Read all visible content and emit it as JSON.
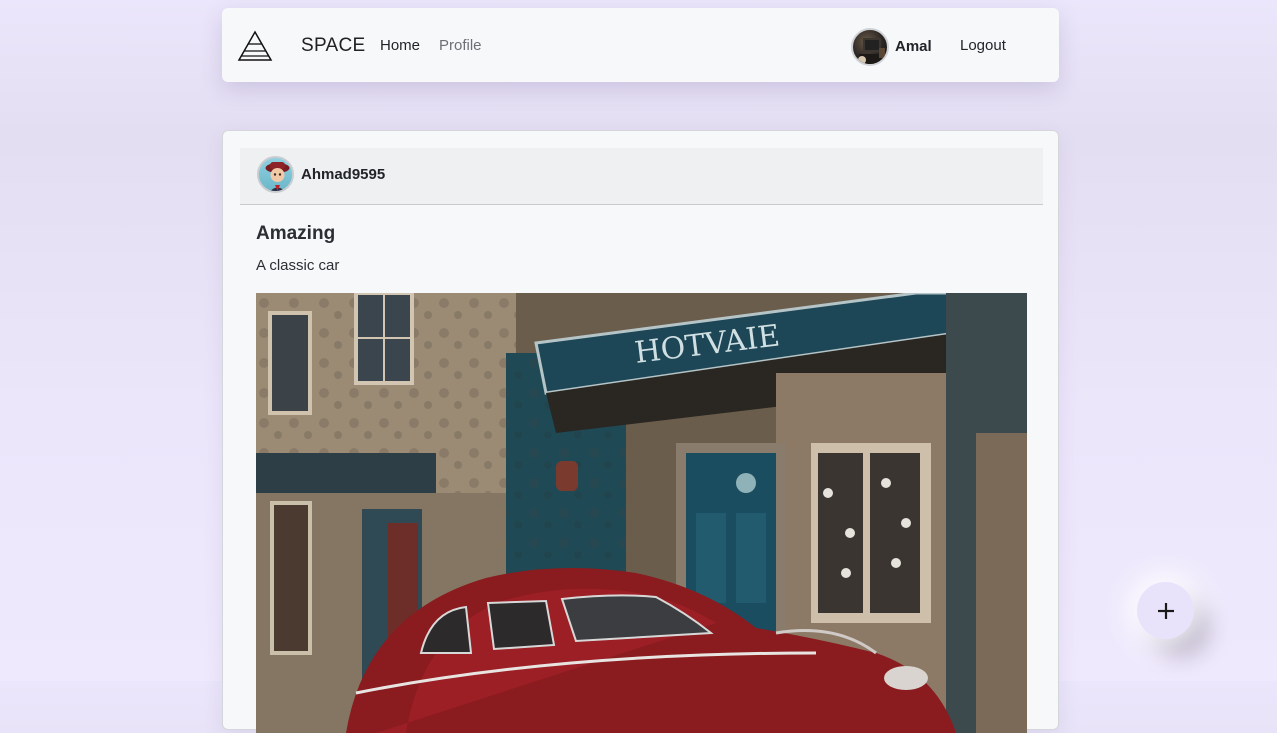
{
  "navbar": {
    "brand": "SPACE",
    "links": [
      {
        "label": "Home"
      },
      {
        "label": "Profile"
      }
    ],
    "user": {
      "name": "Amal",
      "avatar_icon": "user-avatar"
    },
    "logout_label": "Logout"
  },
  "post": {
    "author": "Ahmad9595",
    "title": "Amazing",
    "description": "A classic car",
    "image_icon": "classic-car-photo"
  },
  "fab": {
    "icon": "plus-icon"
  }
}
